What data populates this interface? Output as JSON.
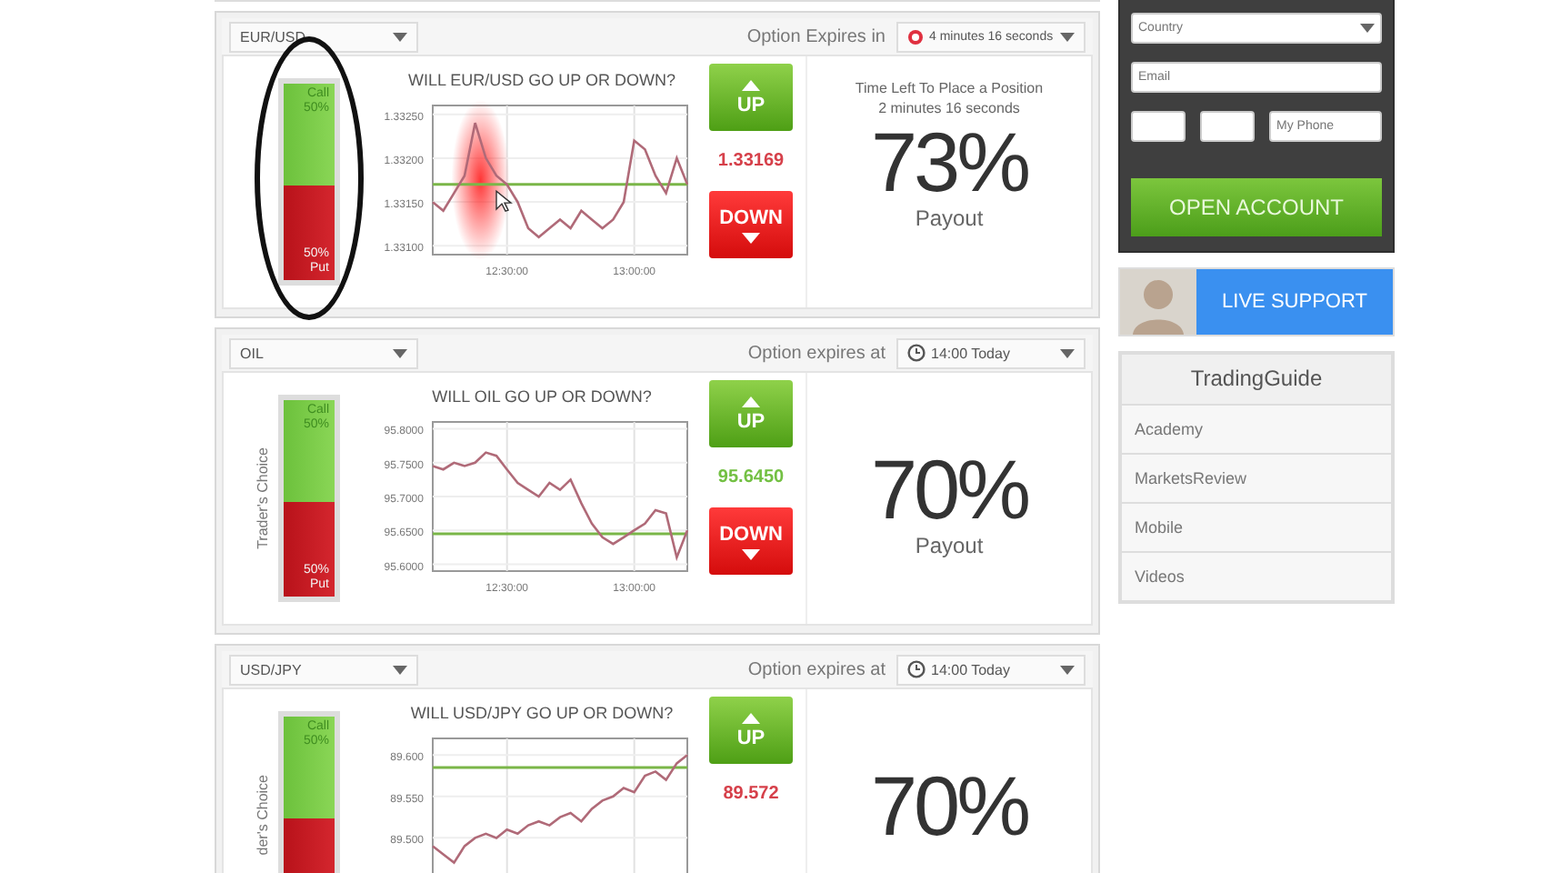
{
  "options": [
    {
      "asset": "EUR/USD",
      "urgent": true,
      "expiry_label": "Option Expires in",
      "expiry_value": "4 minutes 16 seconds",
      "annotation_circle": true,
      "cursor_highlight": true,
      "question": "WILL EUR/USD GO UP OR DOWN?",
      "meter": {
        "call_label": "Call",
        "call_pct": "50%",
        "put_pct": "50%",
        "put_label": "Put",
        "level": 0.5
      },
      "chart_data": {
        "type": "line",
        "categories": [
          null,
          null,
          null,
          null,
          null,
          null,
          null,
          "12:30:00",
          null,
          null,
          null,
          null,
          null,
          null,
          null,
          null,
          null,
          null,
          null,
          "13:00:00",
          null,
          null,
          null,
          null,
          null
        ],
        "ylim": [
          1.3309,
          1.3326
        ],
        "yticks": [
          {
            "value": 1.3325,
            "label": "1.33250"
          },
          {
            "value": 1.332,
            "label": "1.33200"
          },
          {
            "value": 1.3315,
            "label": "1.33150"
          },
          {
            "value": 1.331,
            "label": "1.33100"
          }
        ],
        "series": [
          {
            "color": "#b06a78",
            "values": [
              1.3315,
              1.3314,
              1.3316,
              1.3318,
              1.3324,
              1.332,
              1.3318,
              1.3317,
              1.3315,
              1.3312,
              1.3311,
              1.3312,
              1.3313,
              1.3312,
              1.3314,
              1.3313,
              1.3312,
              1.3313,
              1.3315,
              1.3322,
              1.3321,
              1.3318,
              1.3316,
              1.332,
              1.3317
            ]
          }
        ],
        "grid": true,
        "ref_lines": [
          {
            "axis": "y",
            "value": 1.3317,
            "color": "#7ab648"
          }
        ]
      },
      "up_label": "UP",
      "price": {
        "text": "1.33169",
        "color": "#d6404a"
      },
      "down_label": "DOWN",
      "time_left_label": "Time Left To Place a Position",
      "time_left": "2 minutes 16 seconds",
      "payout": "73%",
      "payout_label": "Payout"
    },
    {
      "asset": "OIL",
      "urgent": false,
      "expiry_label": "Option expires at",
      "expiry_value": "14:00 Today",
      "annotation_circle": false,
      "cursor_highlight": false,
      "side_label": "Trader's Choice",
      "question": "WILL OIL GO UP OR DOWN?",
      "meter": {
        "call_label": "Call",
        "call_pct": "50%",
        "put_pct": "50%",
        "put_label": "Put",
        "level": 0.5
      },
      "chart_data": {
        "type": "line",
        "categories": [
          null,
          null,
          null,
          null,
          null,
          null,
          null,
          "12:30:00",
          null,
          null,
          null,
          null,
          null,
          null,
          null,
          null,
          null,
          null,
          null,
          "13:00:00",
          null,
          null,
          null,
          null,
          null
        ],
        "ylim": [
          95.59,
          95.81
        ],
        "yticks": [
          {
            "value": 95.8,
            "label": "95.8000"
          },
          {
            "value": 95.75,
            "label": "95.7500"
          },
          {
            "value": 95.7,
            "label": "95.7000"
          },
          {
            "value": 95.65,
            "label": "95.6500"
          },
          {
            "value": 95.6,
            "label": "95.6000"
          }
        ],
        "series": [
          {
            "color": "#b06a78",
            "values": [
              95.745,
              95.74,
              95.75,
              95.745,
              95.75,
              95.765,
              95.76,
              95.74,
              95.72,
              95.71,
              95.7,
              95.72,
              95.71,
              95.725,
              95.69,
              95.66,
              95.64,
              95.63,
              95.64,
              95.65,
              95.66,
              95.68,
              95.675,
              95.61,
              95.65
            ]
          }
        ],
        "grid": true,
        "ref_lines": [
          {
            "axis": "y",
            "value": 95.645,
            "color": "#7ab648"
          }
        ]
      },
      "up_label": "UP",
      "price": {
        "text": "95.6450",
        "color": "#73c043"
      },
      "down_label": "DOWN",
      "payout": "70%",
      "payout_label": "Payout"
    },
    {
      "asset": "USD/JPY",
      "urgent": false,
      "expiry_label": "Option expires at",
      "expiry_value": "14:00 Today",
      "annotation_circle": false,
      "cursor_highlight": false,
      "side_label": "der's Choice",
      "question": "WILL USD/JPY GO UP OR DOWN?",
      "meter": {
        "call_label": "Call",
        "call_pct": "50%",
        "level": 0.5
      },
      "chart_data": {
        "type": "line",
        "ylim": [
          89.44,
          89.62
        ],
        "yticks": [
          {
            "value": 89.6,
            "label": "89.600"
          },
          {
            "value": 89.55,
            "label": "89.550"
          },
          {
            "value": 89.5,
            "label": "89.500"
          }
        ],
        "series": [
          {
            "color": "#b06a78",
            "values": [
              89.49,
              89.48,
              89.47,
              89.49,
              89.5,
              89.505,
              89.5,
              89.51,
              89.505,
              89.515,
              89.52,
              89.515,
              89.525,
              89.53,
              89.52,
              89.535,
              89.545,
              89.55,
              89.56,
              89.555,
              89.575,
              89.58,
              89.57,
              89.59,
              89.6
            ]
          }
        ],
        "grid": true,
        "ref_lines": [
          {
            "axis": "y",
            "value": 89.585,
            "color": "#7ab648"
          }
        ]
      },
      "up_label": "UP",
      "price": {
        "text": "89.572",
        "color": "#d6404a"
      },
      "payout": "70%"
    }
  ],
  "sidebar": {
    "country_placeholder": "Country",
    "email_placeholder": "Email",
    "phone_placeholder": "My Phone",
    "open_account": "OPEN ACCOUNT",
    "live_support": "LIVE SUPPORT",
    "guide_title": "TradingGuide",
    "guide_items": [
      "Academy",
      "MarketsReview",
      "Mobile",
      "Videos"
    ]
  }
}
